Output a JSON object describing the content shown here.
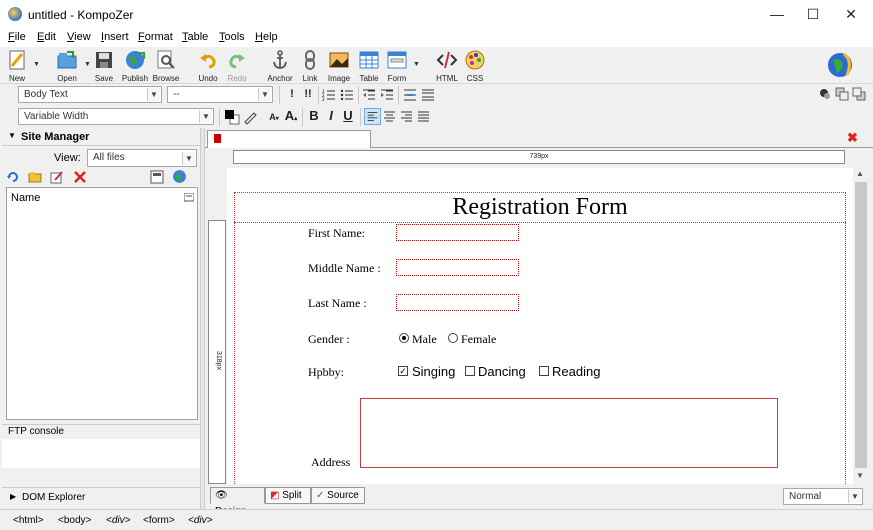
{
  "window": {
    "title": "untitled - KompoZer",
    "controls": [
      "—",
      "☐",
      "✕"
    ]
  },
  "menus": [
    "File",
    "Edit",
    "View",
    "Insert",
    "Format",
    "Table",
    "Tools",
    "Help"
  ],
  "toolbar": {
    "buttons": [
      "New",
      "Open",
      "Save",
      "Publish",
      "Browse",
      "Undo",
      "Redo",
      "Anchor",
      "Link",
      "Image",
      "Table",
      "Form",
      "HTML",
      "CSS"
    ]
  },
  "format": {
    "paragraph_style": "Body Text",
    "font": "--",
    "width": "Variable Width",
    "bold": "B",
    "italic": "I",
    "underline": "U"
  },
  "site_manager": {
    "title": "Site Manager",
    "view_label": "View:",
    "view_value": "All files",
    "column_name": "Name",
    "ftp_console": "FTP console",
    "dom_explorer": "DOM Explorer"
  },
  "ruler": {
    "width_label": "739px",
    "height_label": "318px"
  },
  "form": {
    "heading": "Registration Form",
    "first_name": "First Name:",
    "middle_name": "Middle Name :",
    "last_name": "Last Name :",
    "gender_label": "Gender :",
    "gender_options": [
      "Male",
      "Female"
    ],
    "gender_selected": "Male",
    "hobby_label": "Hpbby:",
    "hobby_options": [
      "Singing",
      "Dancing",
      "Reading"
    ],
    "hobby_checked": [
      "Singing"
    ],
    "address_label": "Address"
  },
  "view_tabs": [
    "Design",
    "Split",
    "Source"
  ],
  "view_mode": "Normal",
  "breadcrumbs": [
    "<html>",
    "<body>",
    "<div>",
    "<form>",
    "<div>"
  ],
  "colors": {
    "accent_selected": "#cce4f7",
    "field_border": "#cc0000"
  }
}
